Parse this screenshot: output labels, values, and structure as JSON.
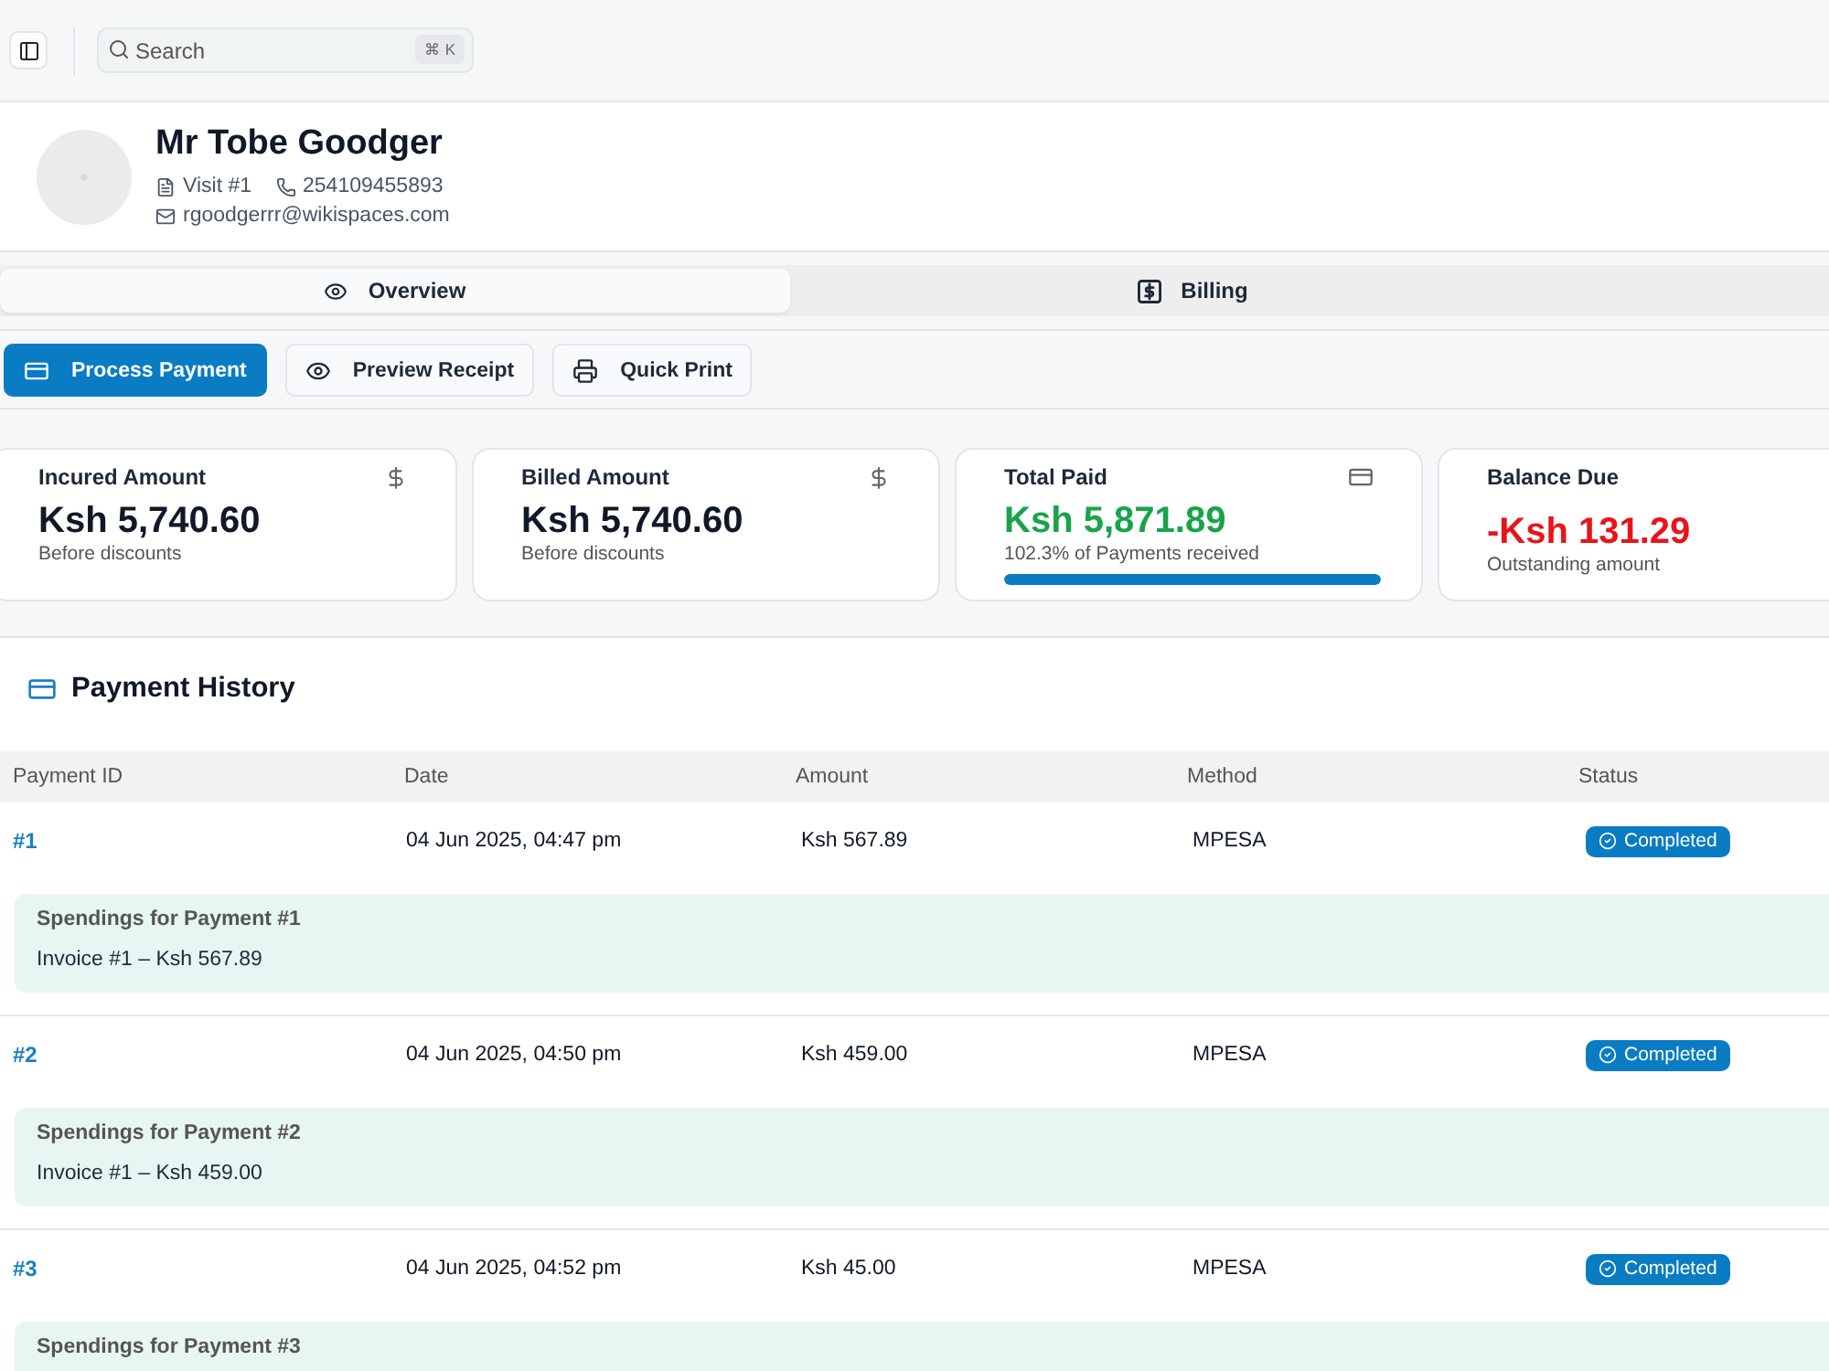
{
  "topbar": {
    "search": {
      "placeholder": "Search",
      "shortcut": "⌘ K"
    }
  },
  "patient": {
    "name": "Mr Tobe Goodger",
    "visit": "Visit #1",
    "phone": "254109455893",
    "email": "rgoodgerrr@wikispaces.com"
  },
  "tabs": [
    {
      "label": "Overview",
      "selected": true
    },
    {
      "label": "Billing",
      "selected": false
    }
  ],
  "actions": [
    {
      "label": "Process Payment",
      "primary": true
    },
    {
      "label": "Preview Receipt",
      "primary": false
    },
    {
      "label": "Quick Print",
      "primary": false
    }
  ],
  "stats": [
    {
      "kind": "amount",
      "label": "Incured Amount",
      "value": "Ksh 5,740.60",
      "note": "Before discounts"
    },
    {
      "kind": "amount",
      "label": "Billed Amount",
      "value": "Ksh 5,740.60",
      "note": "Before discounts"
    },
    {
      "kind": "paid",
      "label": "Total Paid",
      "value": "Ksh 5,871.89",
      "note": "102.3% of Payments received",
      "level": 1
    },
    {
      "kind": "balance",
      "label": "Balance Due",
      "value": "-Ksh 131.29",
      "note": "Outstanding amount"
    }
  ],
  "payment_history": {
    "title": "Payment History",
    "columns": [
      "Payment ID",
      "Date",
      "Amount",
      "Method",
      "Status"
    ],
    "rows": [
      {
        "id": "#1",
        "date": "04 Jun 2025, 04:47 pm",
        "amount": "Ksh 567.89",
        "method": "MPESA",
        "status": "Completed",
        "spendings": {
          "title": "Spendings for Payment #1",
          "items": [
            "Invoice #1 – Ksh 567.89"
          ]
        }
      },
      {
        "id": "#2",
        "date": "04 Jun 2025, 04:50 pm",
        "amount": "Ksh 459.00",
        "method": "MPESA",
        "status": "Completed",
        "spendings": {
          "title": "Spendings for Payment #2",
          "items": [
            "Invoice #1 – Ksh 459.00"
          ]
        }
      },
      {
        "id": "#3",
        "date": "04 Jun 2025, 04:52 pm",
        "amount": "Ksh 45.00",
        "method": "MPESA",
        "status": "Completed",
        "spendings": {
          "title": "Spendings for Payment #3"
        }
      }
    ]
  }
}
